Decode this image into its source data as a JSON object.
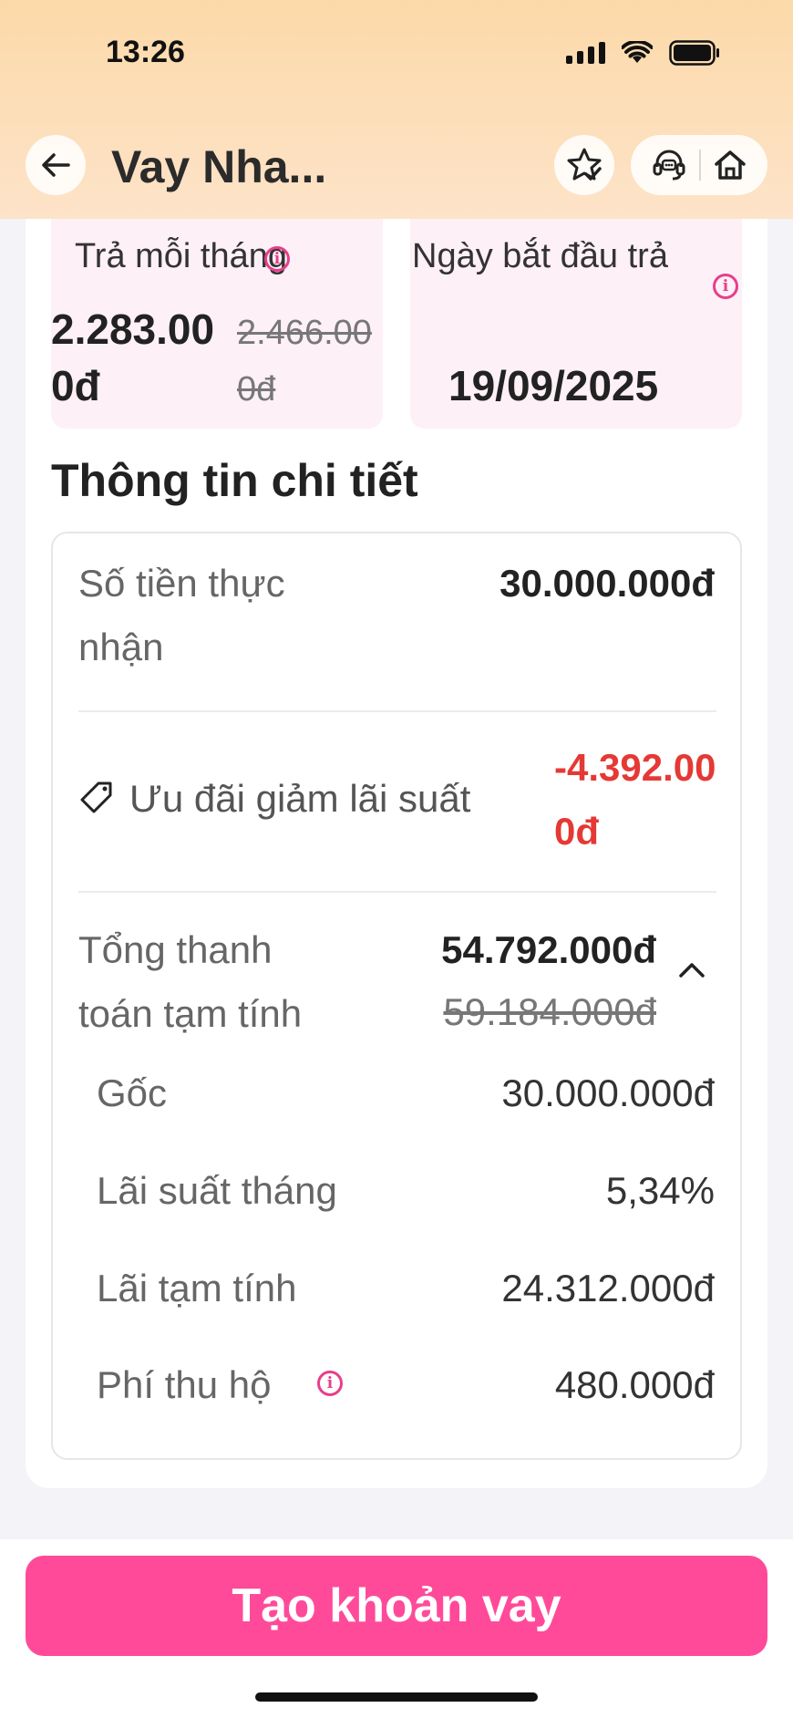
{
  "status_bar": {
    "time": "13:26",
    "icons": [
      "signal-icon",
      "wifi-icon",
      "battery-icon"
    ]
  },
  "header": {
    "title": "Vay Nha...",
    "icons": [
      "back-arrow-icon",
      "star-check-icon",
      "support-headset-icon",
      "home-icon"
    ]
  },
  "summary": {
    "monthly_label": "Trả mỗi tháng",
    "monthly_amount": "2.283.000đ",
    "monthly_old_amount": "2.466.000đ",
    "start_label": "Ngày bắt đầu trả",
    "start_date": "19/09/2025"
  },
  "details": {
    "title": "Thông tin chi tiết",
    "received_label": "Số tiền thực nhận",
    "received_value": "30.000.000đ",
    "discount_label": "Ưu đãi giảm lãi suất",
    "discount_value": "-4.392.000đ",
    "total_label": "Tổng thanh toán tạm tính",
    "total_value": "54.792.000đ",
    "total_old_value": "59.184.000đ",
    "breakdown": [
      {
        "label": "Gốc",
        "value": "30.000.000đ"
      },
      {
        "label": "Lãi suất tháng",
        "value": "5,34%"
      },
      {
        "label": "Lãi tạm tính",
        "value": "24.312.000đ"
      },
      {
        "label": "Phí thu hộ",
        "value": "480.000đ"
      }
    ]
  },
  "actions": {
    "create_loan": "Tạo khoản vay"
  },
  "colors": {
    "accent": "#ff4a9a",
    "discount": "#e53935",
    "header_gradient_top": "#fcd9a8",
    "tile_bg": "#fdf0f6"
  }
}
